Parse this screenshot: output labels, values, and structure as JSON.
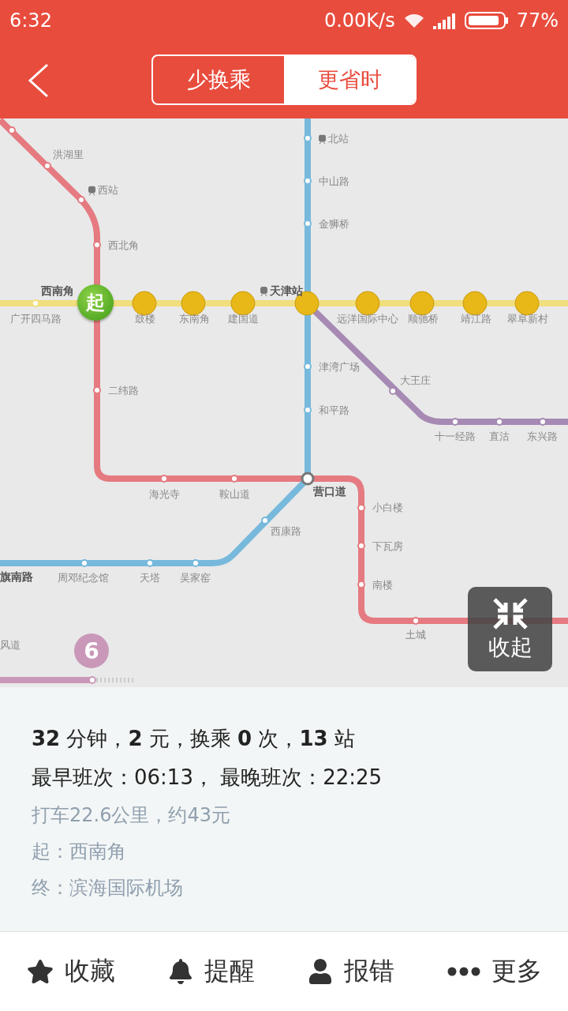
{
  "status_bar": {
    "time": "6:32",
    "speed": "0.00K/s",
    "battery": "77%"
  },
  "header": {
    "tabs": [
      {
        "label": "少换乘",
        "selected": false
      },
      {
        "label": "更省时",
        "selected": true
      }
    ]
  },
  "map": {
    "start_marker": "起",
    "line_badge": "6",
    "collapse_button": "收起",
    "stations": [
      {
        "name": "洪湖里",
        "kind": "normal",
        "railway": false
      },
      {
        "name": "西站",
        "kind": "normal",
        "railway": true
      },
      {
        "name": "西北角",
        "kind": "normal",
        "railway": false
      },
      {
        "name": "西南角",
        "kind": "bold",
        "railway": false
      },
      {
        "name": "广开四马路",
        "kind": "normal",
        "railway": false
      },
      {
        "name": "鼓楼",
        "kind": "normal",
        "railway": false
      },
      {
        "name": "东南角",
        "kind": "normal",
        "railway": false
      },
      {
        "name": "建国道",
        "kind": "normal",
        "railway": false
      },
      {
        "name": "天津站",
        "kind": "bold",
        "railway": true
      },
      {
        "name": "北站",
        "kind": "normal",
        "railway": true
      },
      {
        "name": "中山路",
        "kind": "normal",
        "railway": false
      },
      {
        "name": "金狮桥",
        "kind": "normal",
        "railway": false
      },
      {
        "name": "远洋国际中心",
        "kind": "normal",
        "railway": false
      },
      {
        "name": "顺驰桥",
        "kind": "normal",
        "railway": false
      },
      {
        "name": "靖江路",
        "kind": "normal",
        "railway": false
      },
      {
        "name": "翠阜新村",
        "kind": "normal",
        "railway": false
      },
      {
        "name": "津湾广场",
        "kind": "normal",
        "railway": false
      },
      {
        "name": "和平路",
        "kind": "normal",
        "railway": false
      },
      {
        "name": "大王庄",
        "kind": "normal",
        "railway": false
      },
      {
        "name": "十一经路",
        "kind": "normal",
        "railway": false
      },
      {
        "name": "直沽",
        "kind": "normal",
        "railway": false
      },
      {
        "name": "东兴路",
        "kind": "normal",
        "railway": false
      },
      {
        "name": "二纬路",
        "kind": "normal",
        "railway": false
      },
      {
        "name": "海光寺",
        "kind": "normal",
        "railway": false
      },
      {
        "name": "鞍山道",
        "kind": "normal",
        "railway": false
      },
      {
        "name": "营口道",
        "kind": "bold",
        "railway": false
      },
      {
        "name": "小白楼",
        "kind": "normal",
        "railway": false
      },
      {
        "name": "下瓦房",
        "kind": "normal",
        "railway": false
      },
      {
        "name": "南楼",
        "kind": "normal",
        "railway": false
      },
      {
        "name": "西康路",
        "kind": "normal",
        "railway": false
      },
      {
        "name": "旗南路",
        "kind": "bold",
        "railway": false
      },
      {
        "name": "周邓纪念馆",
        "kind": "normal",
        "railway": false
      },
      {
        "name": "天塔",
        "kind": "normal",
        "railway": false
      },
      {
        "name": "吴家窑",
        "kind": "normal",
        "railway": false
      },
      {
        "name": "土城",
        "kind": "normal",
        "railway": false
      },
      {
        "name": "风道",
        "kind": "normal",
        "railway": false
      }
    ]
  },
  "summary": {
    "headline": "**32** 分钟，**2** 元，换乘 **0** 次，**13** 站",
    "schedule": "最早班次：06:13， 最晚班次：22:25",
    "taxi": "打车22.6公里，约43元",
    "origin": "起：西南角",
    "destination": "终：滨海国际机场"
  },
  "actions": [
    {
      "kind": "star",
      "label": "收藏"
    },
    {
      "kind": "bell",
      "label": "提醒"
    },
    {
      "kind": "person",
      "label": "报错"
    },
    {
      "kind": "more",
      "label": "更多"
    }
  ]
}
